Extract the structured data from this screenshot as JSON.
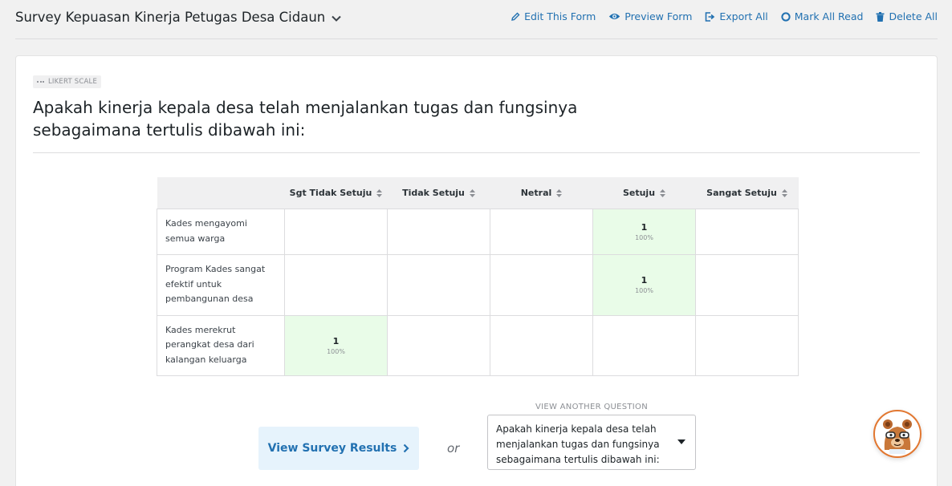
{
  "header": {
    "form_title": "Survey Kepuasan Kinerja Petugas Desa Cidaun",
    "actions": [
      {
        "label": "Edit This Form",
        "icon": "pencil-icon"
      },
      {
        "label": "Preview Form",
        "icon": "eye-icon"
      },
      {
        "label": "Export All",
        "icon": "export-icon"
      },
      {
        "label": "Mark All Read",
        "icon": "circle-icon"
      },
      {
        "label": "Delete All",
        "icon": "trash-icon"
      }
    ]
  },
  "question": {
    "type_badge": "LIKERT SCALE",
    "text": "Apakah kinerja kepala desa telah menjalankan tugas dan fungsinya sebagaimana tertulis dibawah ini:"
  },
  "likert": {
    "columns": [
      "Sgt Tidak Setuju",
      "Tidak Setuju",
      "Netral",
      "Setuju",
      "Sangat Setuju"
    ],
    "rows": [
      {
        "label": "Kades mengayomi semua warga",
        "cells": [
          "",
          "",
          "",
          {
            "count": "1",
            "pct": "100%"
          },
          ""
        ]
      },
      {
        "label": "Program Kades sangat efektif untuk pembangunan desa",
        "cells": [
          "",
          "",
          "",
          {
            "count": "1",
            "pct": "100%"
          },
          ""
        ]
      },
      {
        "label": "Kades merekrut perangkat desa dari kalangan keluarga",
        "cells": [
          {
            "count": "1",
            "pct": "100%"
          },
          "",
          "",
          "",
          ""
        ]
      }
    ]
  },
  "footer": {
    "results_button": "View Survey Results",
    "or_text": "or",
    "view_another_label": "VIEW ANOTHER QUESTION",
    "selected_question": "Apakah kinerja kepala desa telah menjalankan tugas dan fungsinya sebagaimana tertulis dibawah ini:"
  },
  "colors": {
    "accent": "#2271b1",
    "highlight_cell": "#e9fce8",
    "button_bg": "#e6f3fc",
    "mascot_ring": "#e27730"
  }
}
